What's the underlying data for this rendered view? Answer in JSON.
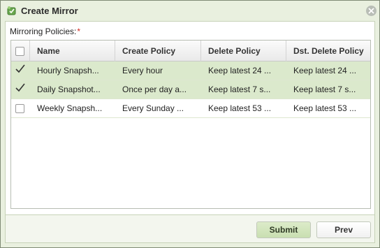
{
  "window": {
    "title": "Create Mirror",
    "close_icon": "close-icon",
    "app_icon": "mirror-app-icon"
  },
  "form": {
    "policies_label": "Mirroring Policies:",
    "required_marker": "*"
  },
  "grid": {
    "columns": [
      "Name",
      "Create Policy",
      "Delete Policy",
      "Dst. Delete Policy"
    ],
    "rows": [
      {
        "checked": true,
        "name": "Hourly Snapsh...",
        "create": "Every hour",
        "delete": "Keep latest 24 ...",
        "dst_delete": "Keep latest 24 ..."
      },
      {
        "checked": true,
        "name": "Daily Snapshot...",
        "create": "Once per day a...",
        "delete": "Keep latest 7 s...",
        "dst_delete": "Keep latest 7 s..."
      },
      {
        "checked": false,
        "name": "Weekly Snapsh...",
        "create": "Every Sunday ...",
        "delete": "Keep latest 53 ...",
        "dst_delete": "Keep latest 53 ..."
      }
    ]
  },
  "buttons": {
    "submit": "Submit",
    "prev": "Prev"
  },
  "colors": {
    "selected_row": "#dbe9cc",
    "frame_bg": "#e9f0df",
    "required": "#d0281f"
  }
}
